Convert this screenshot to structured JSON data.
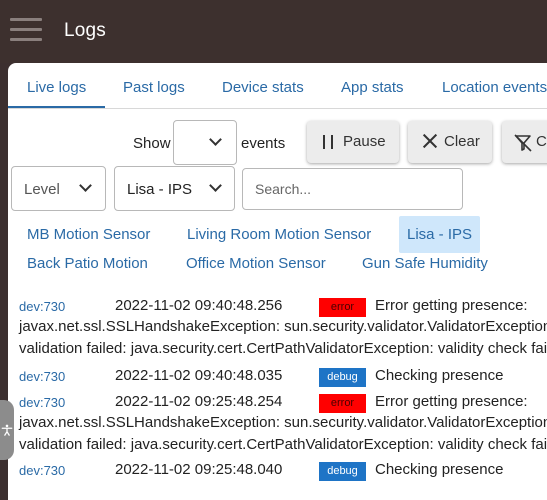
{
  "header": {
    "title": "Logs"
  },
  "tabs": [
    {
      "label": "Live logs"
    },
    {
      "label": "Past logs"
    },
    {
      "label": "Device stats"
    },
    {
      "label": "App stats"
    },
    {
      "label": "Location events"
    }
  ],
  "toolbar": {
    "show_label": "Show",
    "events_label": "events",
    "events_value": "",
    "pause_label": "Pause",
    "clear_label": "Clear",
    "filter_label": "Cl"
  },
  "filters": {
    "level_label": "Level",
    "device_selected": "Lisa - IPS",
    "search_placeholder": "Search..."
  },
  "devices": [
    {
      "label": "MB Motion Sensor"
    },
    {
      "label": "Living Room Motion Sensor"
    },
    {
      "label": "Lisa - IPS",
      "active": true
    },
    {
      "label": "Back Patio Motion"
    },
    {
      "label": "Office Motion Sensor"
    },
    {
      "label": "Gun Safe Humidity"
    }
  ],
  "logs": [
    {
      "dev": "dev:730",
      "time": "2022-11-02 09:40:48.256",
      "level": "error",
      "message": "Error getting presence:",
      "continuation": [
        "javax.net.ssl.SSLHandshakeException: sun.security.validator.ValidatorException: PKIX path",
        "validation failed: java.security.cert.CertPathValidatorException: validity check failed"
      ]
    },
    {
      "dev": "dev:730",
      "time": "2022-11-02 09:40:48.035",
      "level": "debug",
      "message": "Checking presence",
      "continuation": []
    },
    {
      "dev": "dev:730",
      "time": "2022-11-02 09:25:48.254",
      "level": "error",
      "message": "Error getting presence:",
      "continuation": [
        "javax.net.ssl.SSLHandshakeException: sun.security.validator.ValidatorException: PKIX path",
        "validation failed: java.security.cert.CertPathValidatorException: validity check failed"
      ]
    },
    {
      "dev": "dev:730",
      "time": "2022-11-02 09:25:48.040",
      "level": "debug",
      "message": "Checking presence",
      "continuation": []
    }
  ],
  "colors": {
    "topbar": "#3d302e",
    "link": "#2a6aa6",
    "error_badge": "#ff0000",
    "debug_badge": "#1e74c6",
    "active_chip": "#cfe7fb"
  }
}
